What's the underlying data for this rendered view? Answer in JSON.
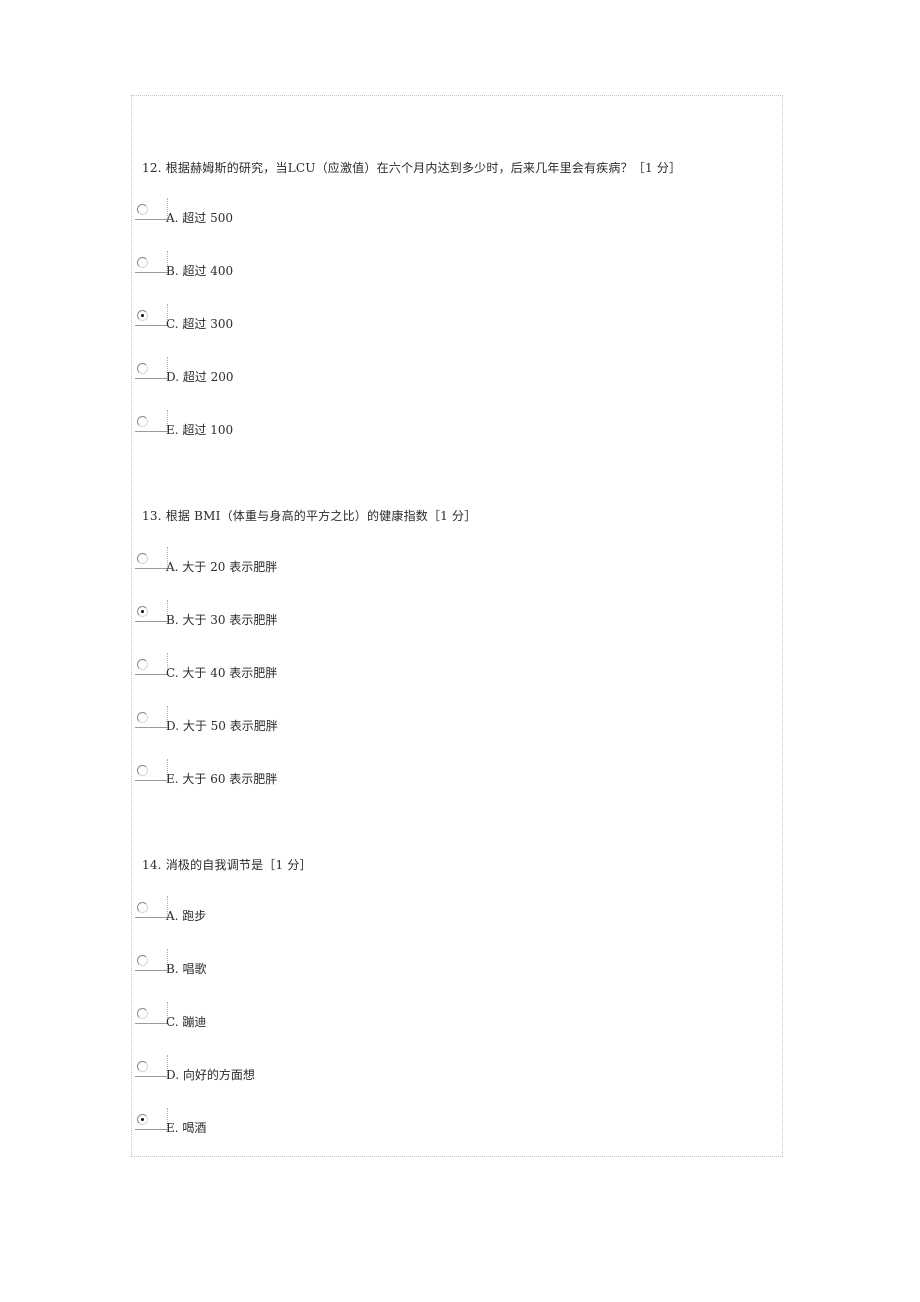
{
  "questions": [
    {
      "number": "12.",
      "text": "根据赫姆斯的研究，当LCU（应激值）在六个月内达到多少时，后来几年里会有疾病？［1 分］",
      "options": [
        {
          "label": "A. 超过 500",
          "checked": false
        },
        {
          "label": "B. 超过 400",
          "checked": false
        },
        {
          "label": "C. 超过 300",
          "checked": true
        },
        {
          "label": "D. 超过 200",
          "checked": false
        },
        {
          "label": "E. 超过 100",
          "checked": false
        }
      ]
    },
    {
      "number": "13.",
      "text": "根据 BMI（体重与身高的平方之比）的健康指数［1 分］",
      "options": [
        {
          "label": "A. 大于 20 表示肥胖",
          "checked": false
        },
        {
          "label": "B. 大于 30 表示肥胖",
          "checked": true
        },
        {
          "label": "C. 大于 40 表示肥胖",
          "checked": false
        },
        {
          "label": "D. 大于 50 表示肥胖",
          "checked": false
        },
        {
          "label": "E. 大于 60 表示肥胖",
          "checked": false
        }
      ]
    },
    {
      "number": "14.",
      "text": "消极的自我调节是［1 分］",
      "options": [
        {
          "label": "A. 跑步",
          "checked": false
        },
        {
          "label": "B. 唱歌",
          "checked": false
        },
        {
          "label": "C. 蹦迪",
          "checked": false
        },
        {
          "label": "D. 向好的方面想",
          "checked": false
        },
        {
          "label": "E. 喝酒",
          "checked": true
        }
      ]
    }
  ]
}
